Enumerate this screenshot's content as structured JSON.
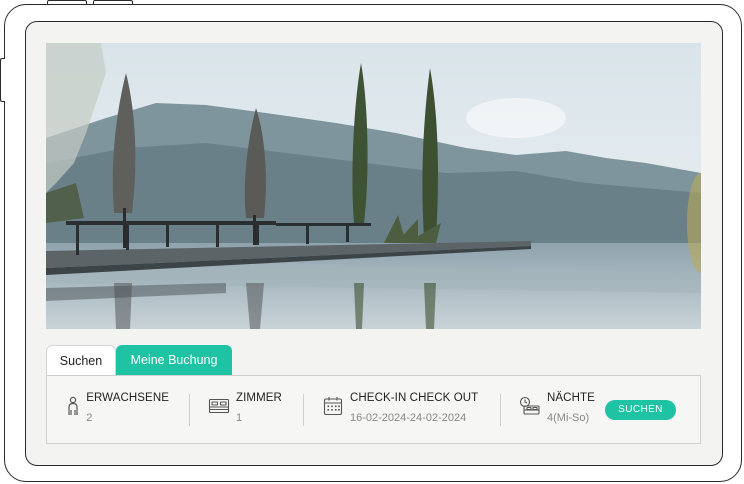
{
  "tabs": [
    {
      "label": "Suchen"
    },
    {
      "label": "Meine Buchung"
    }
  ],
  "booking": {
    "adults": {
      "label": "ERWACHSENE",
      "value": "2",
      "icon": "person-icon"
    },
    "rooms": {
      "label": "ZIMMER",
      "value": "1",
      "icon": "bed-icon"
    },
    "dates": {
      "label": "CHECK-IN CHECK OUT",
      "value": "16-02-2024-24-02-2024",
      "icon": "calendar-icon"
    },
    "nights": {
      "label": "NÄCHTE",
      "value": "4(Mi-So)",
      "icon": "night-bed-icon"
    },
    "search_label": "SUCHEN"
  },
  "colors": {
    "accent": "#1ec3a3",
    "frame": "#2a2a2a",
    "screen_bg": "#f3f3f1"
  }
}
